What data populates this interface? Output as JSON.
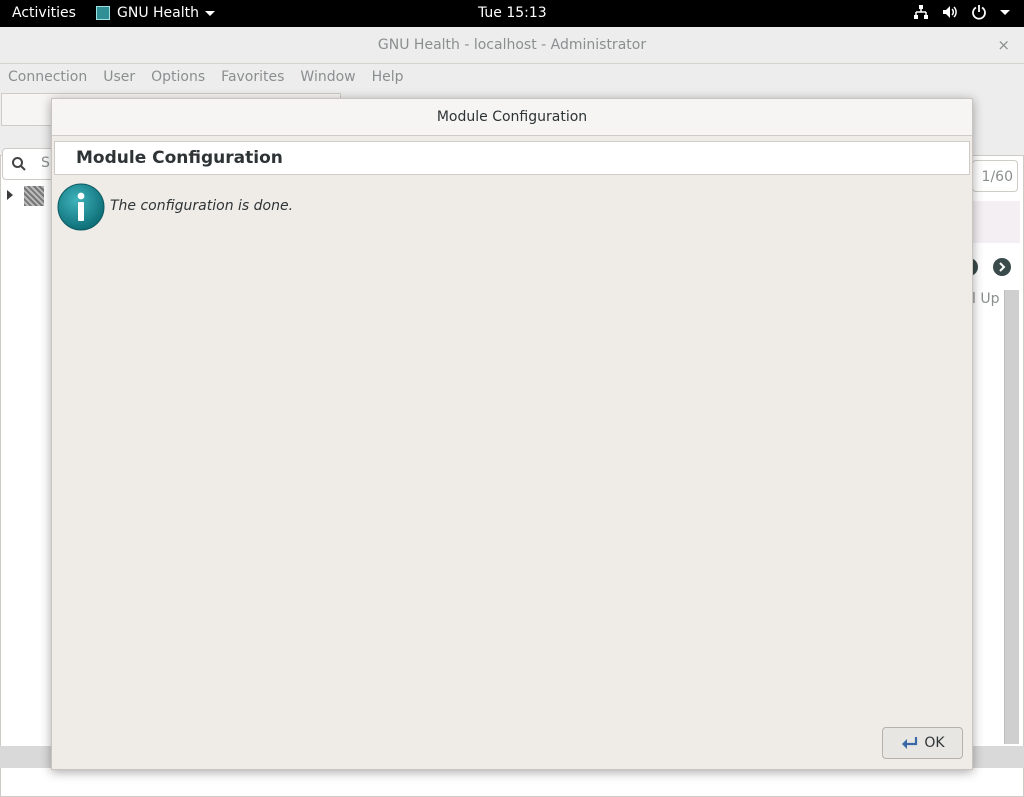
{
  "topbar": {
    "activities": "Activities",
    "app_name": "GNU Health",
    "clock": "Tue 15:13"
  },
  "window": {
    "title": "GNU Health - localhost - Administrator",
    "close_glyph": "×"
  },
  "menubar": {
    "items": [
      "Connection",
      "User",
      "Options",
      "Favorites",
      "Window",
      "Help"
    ]
  },
  "background": {
    "search_partial": "S",
    "record_count": "1/60",
    "column_header_partial": "l Up"
  },
  "dialog": {
    "title": "Module Configuration",
    "header": "Module Configuration",
    "message": "The configuration is done.",
    "ok_label": "OK"
  },
  "colors": {
    "topbar_bg": "#000000",
    "window_bg": "#ededed",
    "dialog_bg": "#efebe7",
    "info_icon": "#1d8f98"
  },
  "icons": [
    "network-icon",
    "volume-icon",
    "power-icon",
    "info-icon",
    "ok-enter-icon",
    "search-icon"
  ]
}
